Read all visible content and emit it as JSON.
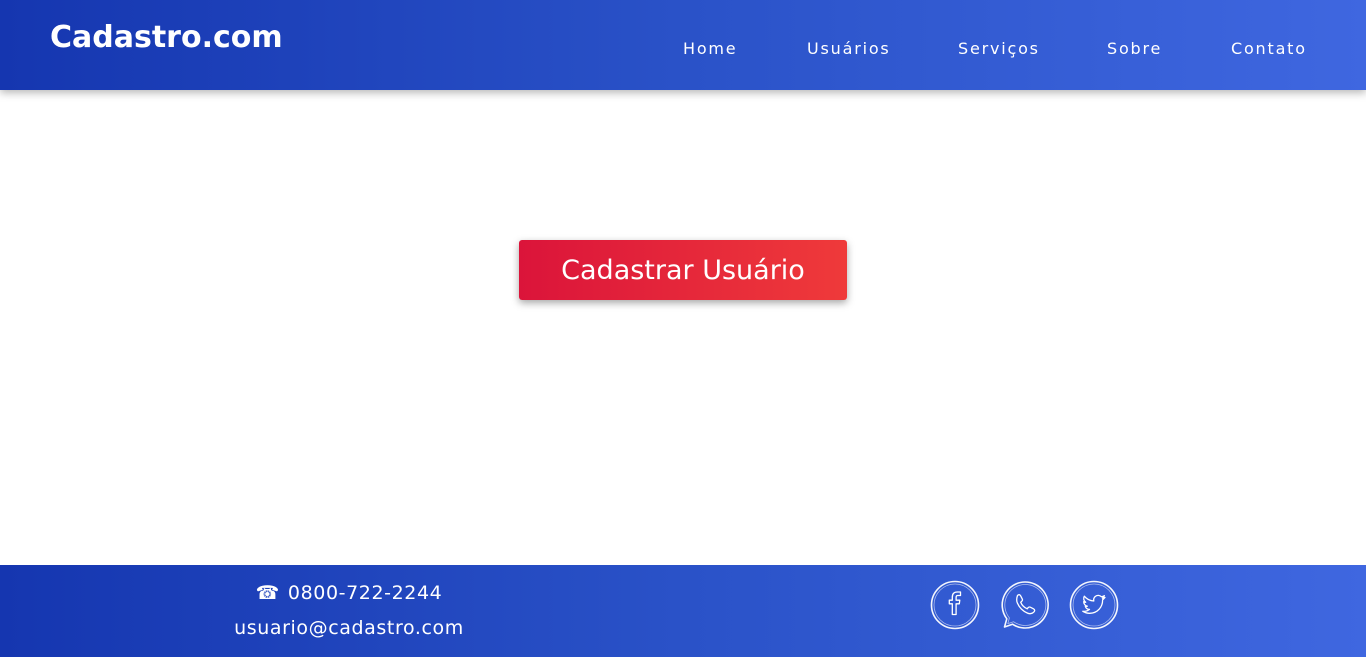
{
  "header": {
    "brand": "Cadastro.com",
    "nav": [
      {
        "label": "Home"
      },
      {
        "label": "Usuários"
      },
      {
        "label": "Serviços"
      },
      {
        "label": "Sobre"
      },
      {
        "label": "Contato"
      }
    ]
  },
  "main": {
    "cta_label": "Cadastrar Usuário"
  },
  "footer": {
    "phone": "0800-722-2244",
    "email": "usuario@cadastro.com",
    "social": [
      {
        "icon": "facebook-icon"
      },
      {
        "icon": "whatsapp-icon"
      },
      {
        "icon": "twitter-icon"
      }
    ]
  },
  "colors": {
    "header_gradient_start": "#1536b0",
    "header_gradient_end": "#3f67e0",
    "cta_gradient_start": "#db143a",
    "cta_gradient_end": "#ef3a3a",
    "text_on_dark": "#ffffff"
  }
}
